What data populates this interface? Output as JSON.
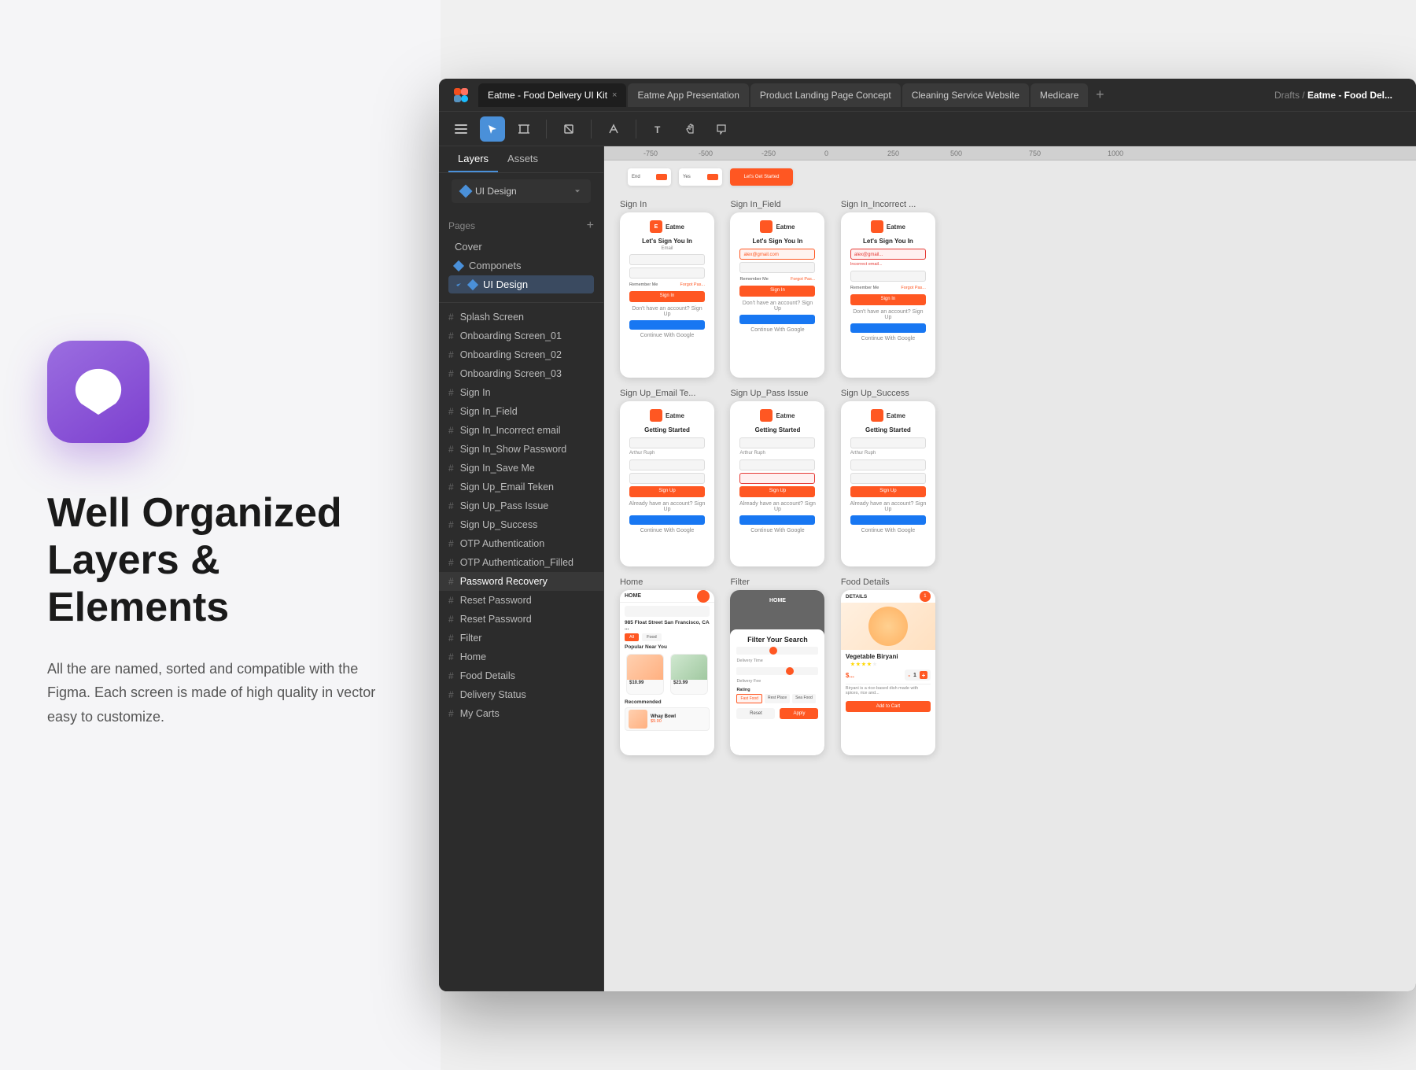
{
  "left": {
    "heading": "Well Organized Layers & Elements",
    "subtext": "All the are named, sorted and compatible with the Figma. Each screen is made of high quality in vector easy to customize."
  },
  "figma": {
    "tabs": [
      {
        "label": "Eatme - Food Delivery UI Kit",
        "active": true
      },
      {
        "label": "Eatme App Presentation",
        "active": false
      },
      {
        "label": "Product Landing Page Concept",
        "active": false
      },
      {
        "label": "Cleaning Service Website",
        "active": false
      },
      {
        "label": "Medicare",
        "active": false
      }
    ],
    "breadcrumb_prefix": "Drafts",
    "breadcrumb_title": "Eatme - Food Del...",
    "sidebar": {
      "tabs": [
        "Layers",
        "Assets"
      ],
      "ui_design_badge": "UI Design",
      "pages_label": "Pages",
      "pages": [
        {
          "label": "Cover",
          "type": "plain"
        },
        {
          "label": "Componets",
          "type": "diamond"
        },
        {
          "label": "UI Design",
          "type": "page",
          "active": true
        }
      ],
      "layers": [
        "Splash Screen",
        "Onboarding Screen_01",
        "Onboarding Screen_02",
        "Onboarding Screen_03",
        "Sign In",
        "Sign In_Field",
        "Sign In_Incorrect email",
        "Sign In_Show Password",
        "Sign In_Save Me",
        "Sign Up_Email Teken",
        "Sign Up_Pass Issue",
        "Sign Up_Success",
        "OTP Authentication",
        "OTP Authentication_Filled",
        "Password Recovery",
        "Reset Password",
        "Reset Password",
        "Filter",
        "Home",
        "Food Details",
        "Delivery Status",
        "My Carts"
      ]
    },
    "canvas": {
      "ruler_marks": [
        "-750",
        "-500",
        "-250",
        "0",
        "250",
        "500",
        "750",
        "1000"
      ],
      "frames": {
        "top_row": [
          {
            "label": ""
          },
          {
            "label": ""
          }
        ],
        "sign_in_row": [
          {
            "label": "Sign In"
          },
          {
            "label": "Sign In_Field"
          },
          {
            "label": "Sign In_Incorrect ..."
          }
        ],
        "sign_up_row": [
          {
            "label": "Sign Up_Email Te..."
          },
          {
            "label": "Sign Up_Pass Issue"
          },
          {
            "label": "Sign Up_Success"
          }
        ],
        "home_row": [
          {
            "label": "Home"
          },
          {
            "label": "Filter"
          },
          {
            "label": "Food Details"
          }
        ]
      }
    }
  }
}
